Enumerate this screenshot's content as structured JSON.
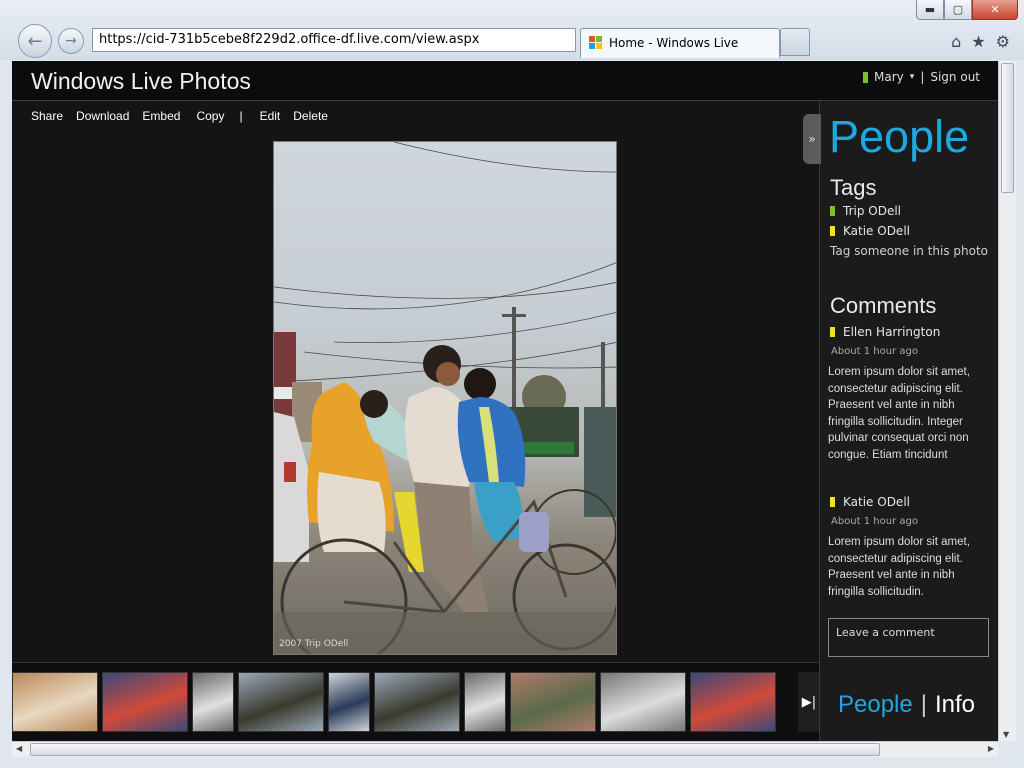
{
  "browser": {
    "url": "https://cid-731b5cebe8f229d2.office-df.live.com/view.aspx",
    "tab_title": "Home - Windows Live",
    "window_buttons": {
      "minimize": "▬",
      "maximize": "▢",
      "close": "✕"
    },
    "nav": {
      "back_icon": "back-arrow-icon",
      "forward_icon": "forward-arrow-icon"
    },
    "tools": {
      "home": "⌂",
      "favorites": "★",
      "settings": "⚙"
    }
  },
  "header": {
    "title": "Windows Live Photos",
    "user_name": "Mary",
    "user_menu_caret": "▾",
    "separator": "|",
    "sign_out": "Sign out",
    "status_color": "#7dc22e"
  },
  "actions": {
    "share": "Share",
    "download": "Download",
    "embed": "Embed",
    "copy": "Copy",
    "separator": "|",
    "edit": "Edit",
    "delete": "Delete"
  },
  "photo": {
    "credit": "2007 Trip ODell"
  },
  "filmstrip": {
    "thumbnails": [
      {
        "name": "thumb-hotdogs",
        "colors": [
          "#b98a5a",
          "#e8d8c0"
        ]
      },
      {
        "name": "thumb-people-booth",
        "colors": [
          "#3a4a7a",
          "#d24a3a"
        ]
      },
      {
        "name": "thumb-water-splash",
        "colors": [
          "#6a6a6a",
          "#e0e0e0"
        ]
      },
      {
        "name": "thumb-beach",
        "colors": [
          "#9aa8b6",
          "#3a3a2e"
        ]
      },
      {
        "name": "thumb-snow-person",
        "colors": [
          "#cfd4d8",
          "#2a3a5a"
        ]
      },
      {
        "name": "thumb-beach-2",
        "colors": [
          "#9aa8b6",
          "#3a3a2e"
        ]
      },
      {
        "name": "thumb-water-splash-2",
        "colors": [
          "#6a6a6a",
          "#e0e0e0"
        ]
      },
      {
        "name": "thumb-street-scene",
        "colors": [
          "#b07a6a",
          "#5a6a4a"
        ]
      },
      {
        "name": "thumb-hotdogs-bw",
        "colors": [
          "#777777",
          "#dddddd"
        ]
      },
      {
        "name": "thumb-people-booth-2",
        "colors": [
          "#3a4a7a",
          "#d24a3a"
        ]
      }
    ],
    "next_label": "▶|"
  },
  "side": {
    "collapse_label": "»",
    "title": "People",
    "tags_heading": "Tags",
    "tags": [
      {
        "name": "Trip ODell",
        "color": "#7dc22e"
      },
      {
        "name": "Katie ODell",
        "color": "#f4e21c"
      }
    ],
    "tag_link": "Tag someone in this photo",
    "comments_heading": "Comments",
    "comments": [
      {
        "author": "Ellen Harrington",
        "color": "#f4e21c",
        "time": "About 1 hour ago",
        "text": "Lorem ipsum dolor sit amet, consectetur adipiscing elit. Praesent vel ante in nibh fringilla sollicitudin. Integer pulvinar consequat orci non congue. Etiam tincidunt"
      },
      {
        "author": "Katie ODell",
        "color": "#f4e21c",
        "time": "About 1 hour ago",
        "text": "Lorem ipsum dolor sit amet, consectetur adipiscing elit. Praesent vel ante in nibh fringilla sollicitudin."
      }
    ],
    "comment_placeholder": "Leave a comment",
    "tabs": {
      "people": "People",
      "separator": "|",
      "info": "Info"
    },
    "accent": "#1fa8e0"
  }
}
